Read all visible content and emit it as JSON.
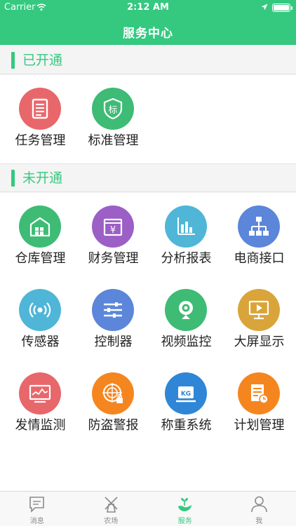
{
  "status_bar": {
    "carrier": "Carrier",
    "time": "2:12 AM"
  },
  "header": {
    "title": "服务中心"
  },
  "colors": {
    "accent": "#34c97f",
    "red": "#e8676b",
    "green": "#3ebb75",
    "purple": "#9b5fc6",
    "blue_light": "#4fb6d8",
    "blue": "#5b86da",
    "orange": "#f5861f",
    "gold": "#d9a53a"
  },
  "sections": [
    {
      "label": "已开通",
      "items": [
        {
          "label": "任务管理",
          "icon": "task-list-icon",
          "color": "#e8676b"
        },
        {
          "label": "标准管理",
          "icon": "standard-shield-icon",
          "color": "#3ebb75"
        }
      ]
    },
    {
      "label": "未开通",
      "items": [
        {
          "label": "仓库管理",
          "icon": "warehouse-icon",
          "color": "#3ebb75"
        },
        {
          "label": "财务管理",
          "icon": "finance-yen-icon",
          "color": "#9b5fc6"
        },
        {
          "label": "分析报表",
          "icon": "bar-chart-icon",
          "color": "#4fb6d8"
        },
        {
          "label": "电商接口",
          "icon": "network-tree-icon",
          "color": "#5b86da"
        },
        {
          "label": "传感器",
          "icon": "sensor-wave-icon",
          "color": "#4fb6d8"
        },
        {
          "label": "控制器",
          "icon": "sliders-icon",
          "color": "#5b86da"
        },
        {
          "label": "视频监控",
          "icon": "webcam-icon",
          "color": "#3ebb75"
        },
        {
          "label": "大屏显示",
          "icon": "screen-play-icon",
          "color": "#d9a53a"
        },
        {
          "label": "发情监测",
          "icon": "monitor-chart-icon",
          "color": "#e8676b"
        },
        {
          "label": "防盗警报",
          "icon": "radar-lock-icon",
          "color": "#f5861f"
        },
        {
          "label": "称重系统",
          "icon": "scale-kg-icon",
          "color": "#2f86d6"
        },
        {
          "label": "计划管理",
          "icon": "plan-doc-icon",
          "color": "#f5861f"
        }
      ]
    }
  ],
  "tabs": [
    {
      "label": "消息",
      "icon": "message-icon",
      "active": false
    },
    {
      "label": "农场",
      "icon": "windmill-icon",
      "active": false
    },
    {
      "label": "服务",
      "icon": "service-leaf-icon",
      "active": true
    },
    {
      "label": "我",
      "icon": "profile-icon",
      "active": false
    }
  ]
}
